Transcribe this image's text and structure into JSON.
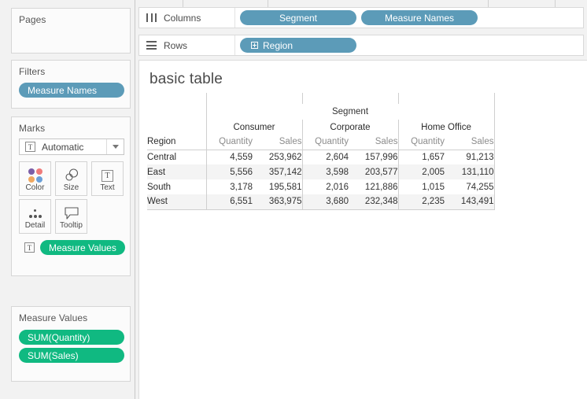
{
  "sidebar": {
    "pages": {
      "title": "Pages"
    },
    "filters": {
      "title": "Filters",
      "pills": [
        {
          "label": "Measure Names",
          "color": "#5c9bb8"
        }
      ]
    },
    "marks": {
      "title": "Marks",
      "mark_type": "Automatic",
      "mark_type_icon_glyph": "T",
      "buttons": [
        {
          "label": "Color",
          "icon": "color-palette-icon"
        },
        {
          "label": "Size",
          "icon": "size-circles-icon"
        },
        {
          "label": "Text",
          "icon": "text-mark-icon"
        },
        {
          "label": "Detail",
          "icon": "detail-dots-icon"
        },
        {
          "label": "Tooltip",
          "icon": "tooltip-bubble-icon"
        }
      ],
      "shelf_pill": {
        "label": "Measure Values",
        "color": "#10b981"
      }
    },
    "measure_values": {
      "title": "Measure Values",
      "pills": [
        {
          "label": "SUM(Quantity)",
          "color": "#10b981"
        },
        {
          "label": "SUM(Sales)",
          "color": "#10b981"
        }
      ]
    }
  },
  "shelves": {
    "columns": {
      "label": "Columns",
      "icon": "columns-icon",
      "pills": [
        {
          "label": "Segment",
          "color": "#5c9bb8"
        },
        {
          "label": "Measure Names",
          "color": "#5c9bb8"
        }
      ]
    },
    "rows": {
      "label": "Rows",
      "icon": "rows-icon",
      "pills": [
        {
          "label": "Region",
          "color": "#5c9bb8",
          "expand_icon": "expand-plus-icon"
        }
      ]
    }
  },
  "view": {
    "title": "basic table"
  },
  "chart_data": {
    "type": "table",
    "title": "basic table",
    "column_group_title": "Segment",
    "row_field": "Region",
    "categories": [
      "Consumer",
      "Corporate",
      "Home Office"
    ],
    "measures": [
      "Quantity",
      "Sales"
    ],
    "rows": [
      "Central",
      "East",
      "South",
      "West"
    ],
    "values": [
      [
        "4,559",
        "253,962",
        "2,604",
        "157,996",
        "1,657",
        "91,213"
      ],
      [
        "5,556",
        "357,142",
        "3,598",
        "203,577",
        "2,005",
        "131,110"
      ],
      [
        "3,178",
        "195,581",
        "2,016",
        "121,886",
        "1,015",
        "74,255"
      ],
      [
        "6,551",
        "363,975",
        "3,680",
        "232,348",
        "2,235",
        "143,491"
      ]
    ],
    "series": [
      {
        "name": "Consumer Quantity",
        "values": [
          4559,
          5556,
          3178,
          6551
        ]
      },
      {
        "name": "Consumer Sales",
        "values": [
          253962,
          357142,
          195581,
          363975
        ]
      },
      {
        "name": "Corporate Quantity",
        "values": [
          2604,
          3598,
          2016,
          3680
        ]
      },
      {
        "name": "Corporate Sales",
        "values": [
          157996,
          203577,
          121886,
          232348
        ]
      },
      {
        "name": "Home Office Quantity",
        "values": [
          1657,
          2005,
          1015,
          2235
        ]
      },
      {
        "name": "Home Office Sales",
        "values": [
          91213,
          131110,
          74255,
          143491
        ]
      }
    ],
    "grid": true,
    "legend": "none"
  }
}
